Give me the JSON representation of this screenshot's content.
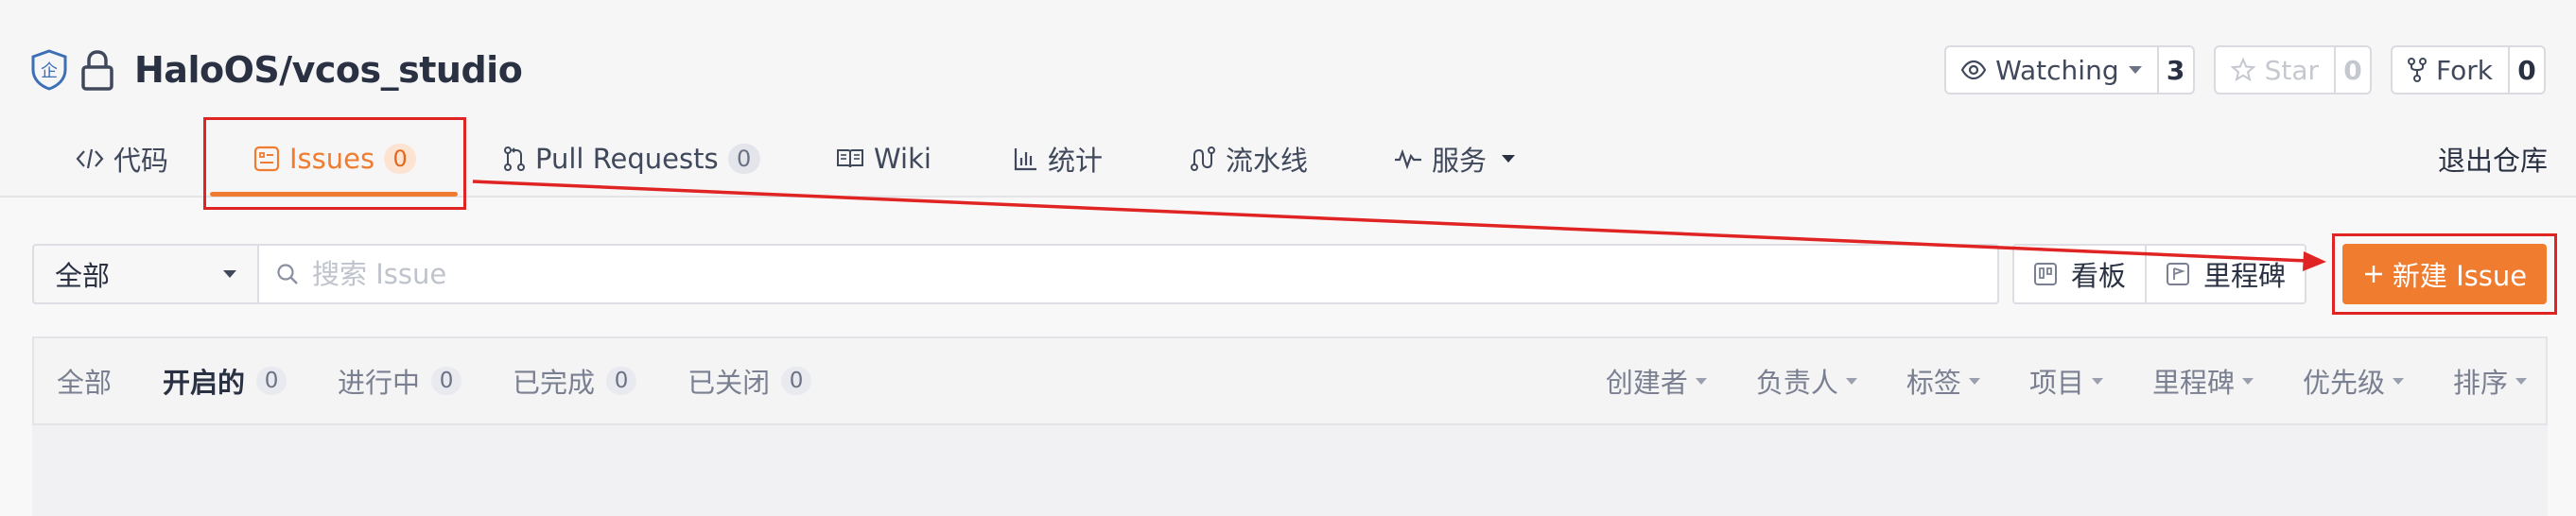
{
  "repo": {
    "name": "HaloOS/vcos_studio"
  },
  "actions": {
    "watch": {
      "label": "Watching",
      "count": "3"
    },
    "star": {
      "label": "Star",
      "count": "0"
    },
    "fork": {
      "label": "Fork",
      "count": "0"
    }
  },
  "tabs": [
    {
      "label": "代码",
      "icon": "code-icon"
    },
    {
      "label": "Issues",
      "badge": "0",
      "icon": "issues-icon",
      "active": true
    },
    {
      "label": "Pull Requests",
      "badge": "0",
      "icon": "pull-request-icon"
    },
    {
      "label": "Wiki",
      "icon": "book-icon"
    },
    {
      "label": "统计",
      "icon": "chart-icon"
    },
    {
      "label": "流水线",
      "icon": "pipeline-icon"
    },
    {
      "label": "服务",
      "icon": "pulse-icon"
    }
  ],
  "exit_repo": "退出仓库",
  "toolbar": {
    "scope_select": "全部",
    "search_placeholder": "搜索 Issue",
    "board_label": "看板",
    "milestone_label": "里程碑",
    "new_issue_label": "新建 Issue"
  },
  "state_tabs": [
    {
      "label": "全部"
    },
    {
      "label": "开启的",
      "badge": "0",
      "active": true
    },
    {
      "label": "进行中",
      "badge": "0"
    },
    {
      "label": "已完成",
      "badge": "0"
    },
    {
      "label": "已关闭",
      "badge": "0"
    }
  ],
  "filters": [
    "创建者",
    "负责人",
    "标签",
    "项目",
    "里程碑",
    "优先级",
    "排序"
  ],
  "colors": {
    "accent": "#f07c2f",
    "annotation": "#e02424"
  }
}
